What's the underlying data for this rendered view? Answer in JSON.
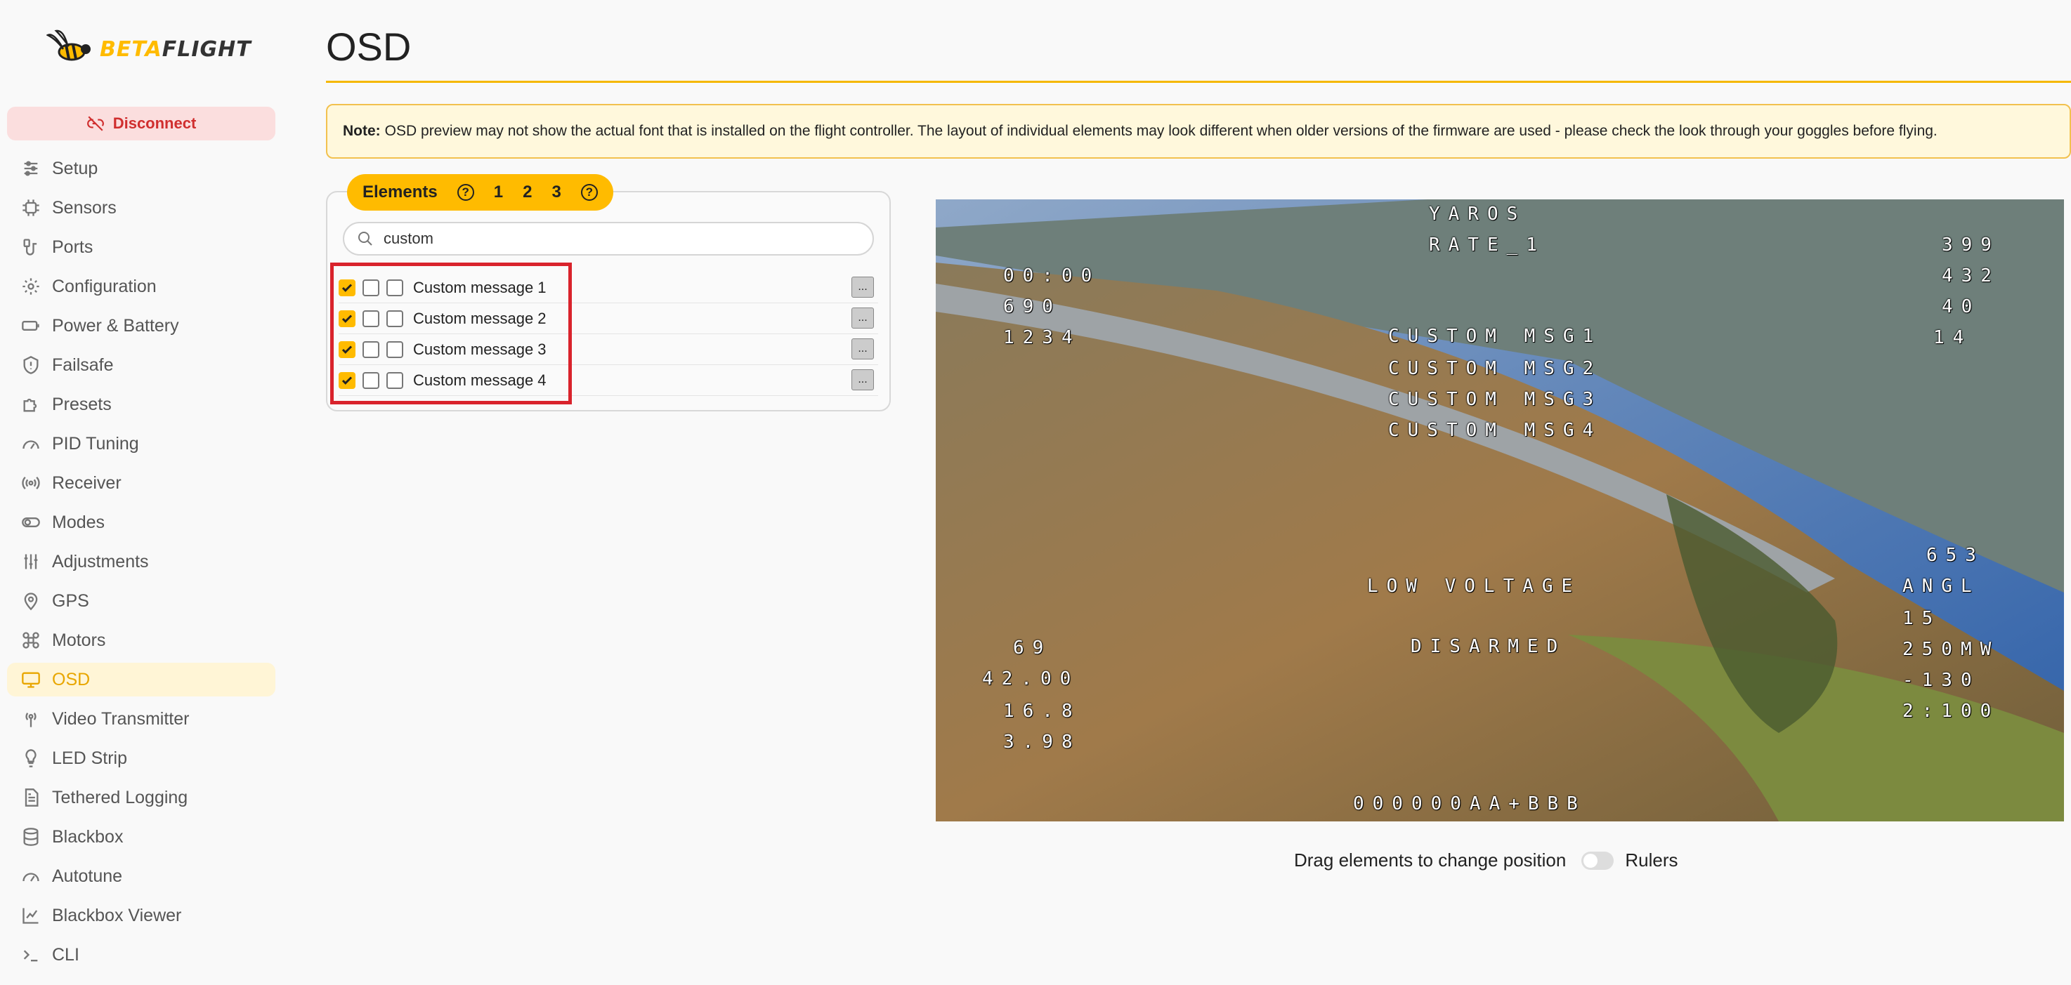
{
  "brand": {
    "logo_text_a": "BETA",
    "logo_text_b": "FLIGHT"
  },
  "disconnect_label": "Disconnect",
  "sidebar": {
    "items": [
      {
        "label": "Setup",
        "icon": "sliders-icon"
      },
      {
        "label": "Sensors",
        "icon": "chip-icon"
      },
      {
        "label": "Ports",
        "icon": "plug-icon"
      },
      {
        "label": "Configuration",
        "icon": "gear-icon"
      },
      {
        "label": "Power & Battery",
        "icon": "battery-icon"
      },
      {
        "label": "Failsafe",
        "icon": "shield-icon"
      },
      {
        "label": "Presets",
        "icon": "puzzle-icon"
      },
      {
        "label": "PID Tuning",
        "icon": "gauge-icon"
      },
      {
        "label": "Receiver",
        "icon": "broadcast-icon"
      },
      {
        "label": "Modes",
        "icon": "toggle-icon"
      },
      {
        "label": "Adjustments",
        "icon": "adjust-icon"
      },
      {
        "label": "GPS",
        "icon": "pin-icon"
      },
      {
        "label": "Motors",
        "icon": "motor-icon"
      },
      {
        "label": "OSD",
        "icon": "monitor-icon",
        "active": true
      },
      {
        "label": "Video Transmitter",
        "icon": "antenna-icon"
      },
      {
        "label": "LED Strip",
        "icon": "bulb-icon"
      },
      {
        "label": "Tethered Logging",
        "icon": "document-icon"
      },
      {
        "label": "Blackbox",
        "icon": "database-icon"
      },
      {
        "label": "Autotune",
        "icon": "gauge-icon"
      },
      {
        "label": "Blackbox Viewer",
        "icon": "chart-icon"
      },
      {
        "label": "CLI",
        "icon": "terminal-icon"
      }
    ]
  },
  "page": {
    "title": "OSD",
    "note_bold": "Note:",
    "note_text": "OSD preview may not show the actual font that is installed on the flight controller. The layout of individual elements may look different when older versions of the firmware are used - please check the look through your goggles before flying."
  },
  "elements_panel": {
    "title": "Elements",
    "profiles": [
      "1",
      "2",
      "3"
    ],
    "search_value": "custom",
    "rows": [
      {
        "label": "Custom message 1",
        "checks": [
          true,
          false,
          false
        ],
        "more": "..."
      },
      {
        "label": "Custom message 2",
        "checks": [
          true,
          false,
          false
        ],
        "more": "..."
      },
      {
        "label": "Custom message 3",
        "checks": [
          true,
          false,
          false
        ],
        "more": "..."
      },
      {
        "label": "Custom message 4",
        "checks": [
          true,
          false,
          false
        ],
        "more": "..."
      }
    ]
  },
  "osd": {
    "craft_name": "YAROS",
    "rate_profile": "RATE_1",
    "fly_time": "00:00",
    "mah_drawn": "690",
    "distance": "1234",
    "custom_msg1": "CUSTOM MSG1",
    "custom_msg2": "CUSTOM MSG2",
    "custom_msg3": "CUSTOM MSG3",
    "custom_msg4": "CUSTOM MSG4",
    "altitude": "399",
    "home_dist": "432",
    "speed": "40",
    "sats": "14",
    "flight_dist": "653",
    "flight_mode": "ANGL",
    "warning": "LOW VOLTAGE",
    "armed_state": "DISARMED",
    "rssi": "69",
    "current": "42.00",
    "battery_voltage": "16.8",
    "cell_voltage": "3.98",
    "link_quality": "15",
    "vtx_power": "250MW",
    "rssi_dbm": "-130",
    "lq_mode": "2:100",
    "gps_coords": "000000AA+BBB"
  },
  "bottom": {
    "drag_hint": "Drag elements to change position",
    "rulers_label": "Rulers"
  }
}
